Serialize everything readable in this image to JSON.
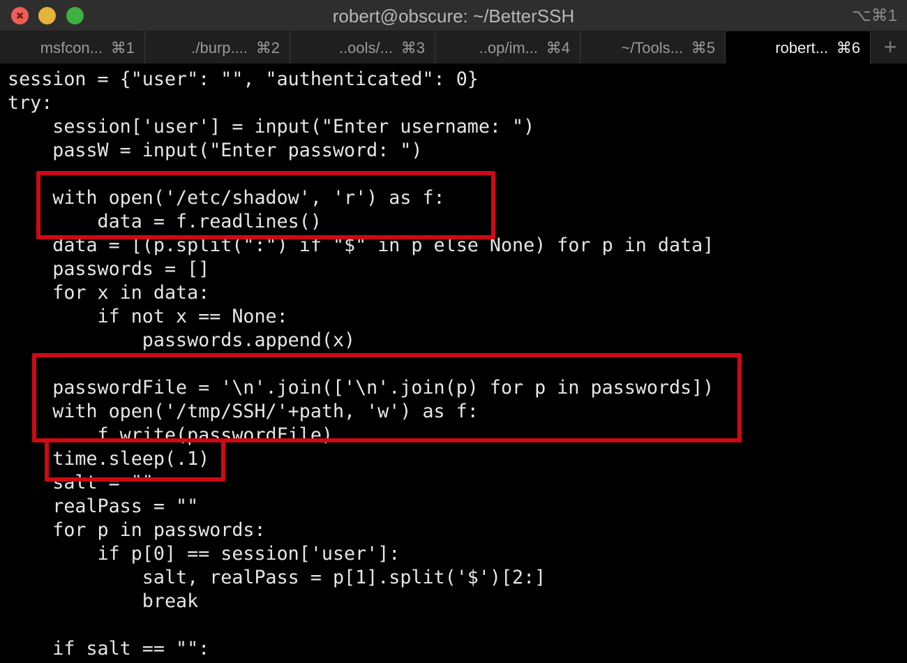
{
  "window": {
    "title": "robert@obscure: ~/BetterSSH",
    "shortcut": "⌥⌘1"
  },
  "tabs": [
    {
      "label": "msfcon...",
      "key": "⌘1"
    },
    {
      "label": "./burp....",
      "key": "⌘2"
    },
    {
      "label": "..ools/...",
      "key": "⌘3"
    },
    {
      "label": "..op/im...",
      "key": "⌘4"
    },
    {
      "label": "~/Tools...",
      "key": "⌘5"
    },
    {
      "label": "robert...",
      "key": "⌘6"
    }
  ],
  "tab_add": "+",
  "code_lines": [
    "session = {\"user\": \"\", \"authenticated\": 0}",
    "try:",
    "    session['user'] = input(\"Enter username: \")",
    "    passW = input(\"Enter password: \")",
    "",
    "    with open('/etc/shadow', 'r') as f:",
    "        data = f.readlines()",
    "    data = [(p.split(\":\") if \"$\" in p else None) for p in data]",
    "    passwords = []",
    "    for x in data:",
    "        if not x == None:",
    "            passwords.append(x)",
    "",
    "    passwordFile = '\\n'.join(['\\n'.join(p) for p in passwords])",
    "    with open('/tmp/SSH/'+path, 'w') as f:",
    "        f.write(passwordFile)",
    "    time.sleep(.1)",
    "    salt = \"\"",
    "    realPass = \"\"",
    "    for p in passwords:",
    "        if p[0] == session['user']:",
    "            salt, realPass = p[1].split('$')[2:]",
    "            break",
    "",
    "    if salt == \"\":"
  ],
  "highlight_color": "#cc0a14"
}
